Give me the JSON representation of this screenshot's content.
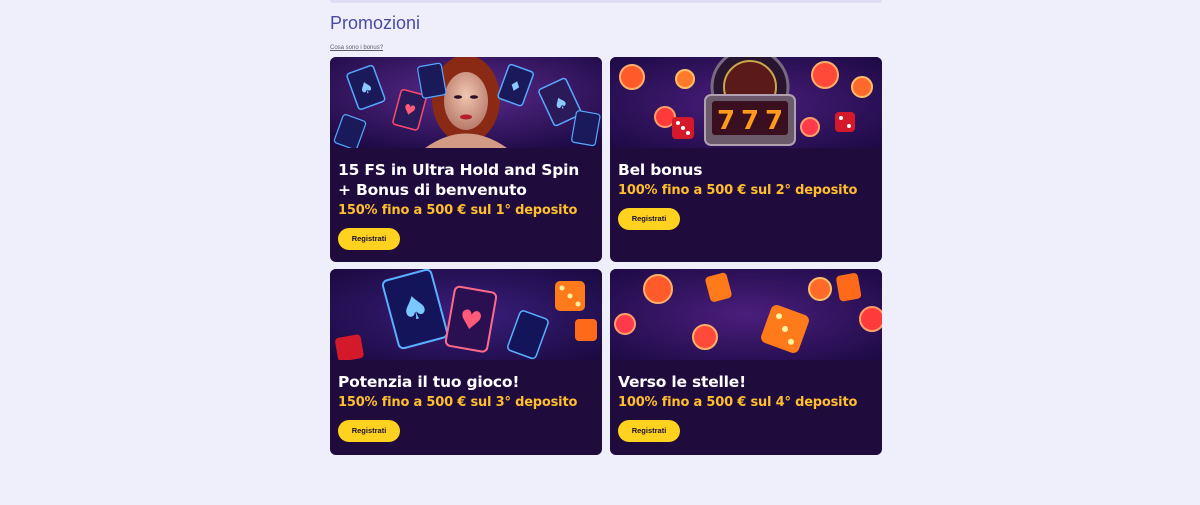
{
  "page": {
    "title": "Promozioni",
    "help_link": "Cosa sono i bonus?"
  },
  "colors": {
    "background": "#efeffb",
    "title": "#4a4aa4",
    "card_bg": "#1f0b3c",
    "offer": "#ffbe2e",
    "button": "#ffd21f"
  },
  "cards": [
    {
      "title": "15 FS in Ultra Hold and Spin + Bonus di benvenuto",
      "offer": "150% fino a 500 € sul 1° deposito",
      "button": "Registrati",
      "image": "woman-and-glowing-cards"
    },
    {
      "title": "Bel bonus",
      "offer": "100% fino a 500 € sul 2° deposito",
      "button": "Registrati",
      "image": "slot-777-roulette-chips"
    },
    {
      "title": "Potenzia il tuo gioco!",
      "offer": "150% fino a 500 € sul 3° deposito",
      "button": "Registrati",
      "image": "glowing-cards-and-dice"
    },
    {
      "title": "Verso le stelle!",
      "offer": "100% fino a 500 € sul 4° deposito",
      "button": "Registrati",
      "image": "chips-and-dice"
    }
  ]
}
